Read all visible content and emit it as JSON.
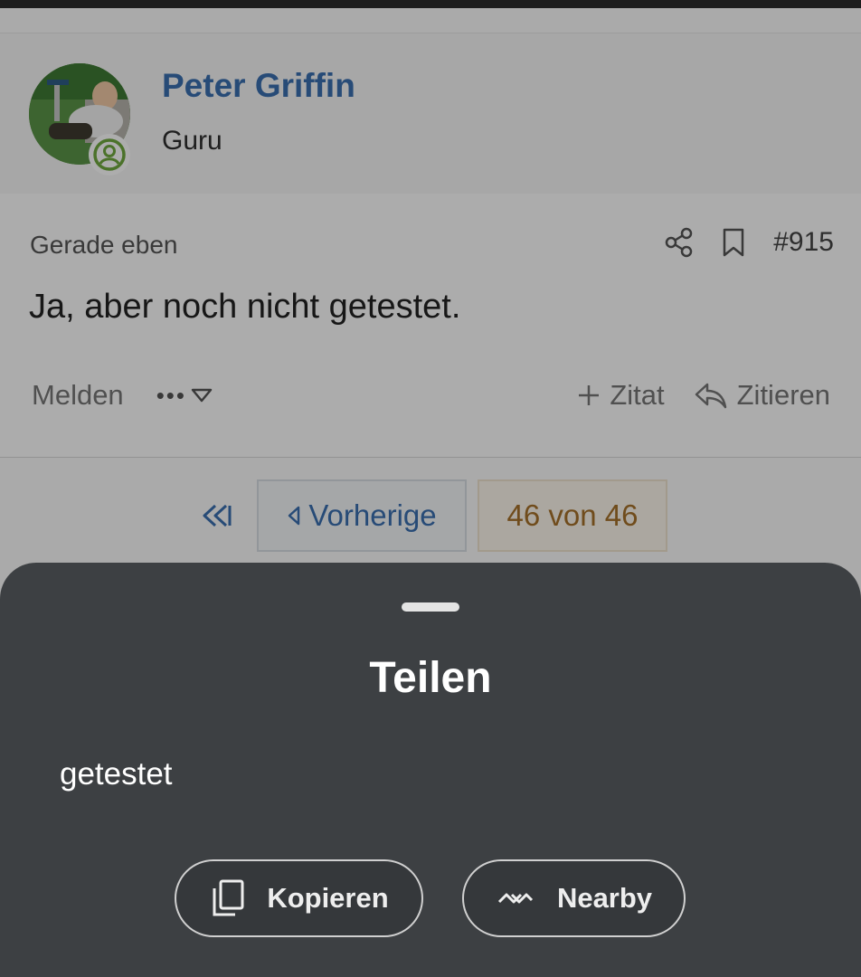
{
  "author": {
    "name": "Peter Griffin",
    "rank": "Guru",
    "avatar_icon": "user-avatar",
    "status_icon": "online-user-icon"
  },
  "post": {
    "time": "Gerade eben",
    "number": "#915",
    "text": "Ja, aber noch nicht getestet.",
    "report_label": "Melden",
    "more_label": "•••",
    "add_quote_label": "Zitat",
    "quote_label": "Zitieren"
  },
  "pagination": {
    "previous_label": "Vorherige",
    "current": "46 von 46"
  },
  "share_sheet": {
    "title": "Teilen",
    "shared_text": "getestet",
    "copy_label": "Kopieren",
    "nearby_label": "Nearby"
  },
  "colors": {
    "accent": "#3a6fb0",
    "sheet_background": "#3d4043",
    "page_indicator": "#a5712a"
  }
}
